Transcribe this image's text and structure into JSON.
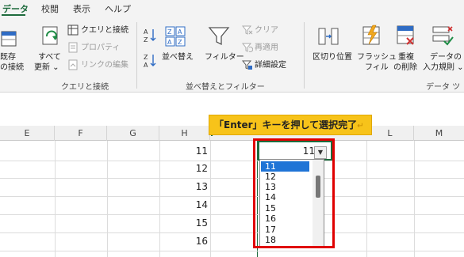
{
  "tabs": [
    {
      "label": "データ",
      "active": true
    },
    {
      "label": "校閲",
      "active": false
    },
    {
      "label": "表示",
      "active": false
    },
    {
      "label": "ヘルプ",
      "active": false
    }
  ],
  "ribbon": {
    "existing_connections": [
      "既存",
      "の接続"
    ],
    "refresh_all": [
      "すべて",
      "更新 ⌄"
    ],
    "queries_connections": "クエリと接続",
    "properties": "プロパティ",
    "edit_links": "リンクの編集",
    "group_queries": "クエリと接続",
    "sort": "並べ替え",
    "filter": "フィルター",
    "clear": "クリア",
    "reapply": "再適用",
    "advanced": "詳細設定",
    "group_sort_filter": "並べ替えとフィルター",
    "text_to_columns": "区切り位置",
    "flash_fill": [
      "フラッシュ",
      "フィル"
    ],
    "remove_duplicates": [
      "重複",
      "の削除"
    ],
    "data_validation": [
      "データの",
      "入力規則 ⌄"
    ],
    "group_data_tools": "データ ツ"
  },
  "grid": {
    "columns": [
      "E",
      "F",
      "G",
      "H",
      "I",
      "L",
      "M"
    ],
    "row_values": [
      "11",
      "12",
      "13",
      "14",
      "15",
      "16"
    ],
    "active_cell_value": "11"
  },
  "callout": {
    "text": "「Enter」キーを押して選択完了",
    "return_mark": "↵"
  },
  "dropdown": {
    "options": [
      "11",
      "12",
      "13",
      "14",
      "15",
      "16",
      "17",
      "18"
    ],
    "selected": "11"
  },
  "colors": {
    "accent_green": "#1e6b3d",
    "highlight_red": "#e00000",
    "callout_yellow": "#f7c31a",
    "selection_blue": "#1f74d6"
  }
}
